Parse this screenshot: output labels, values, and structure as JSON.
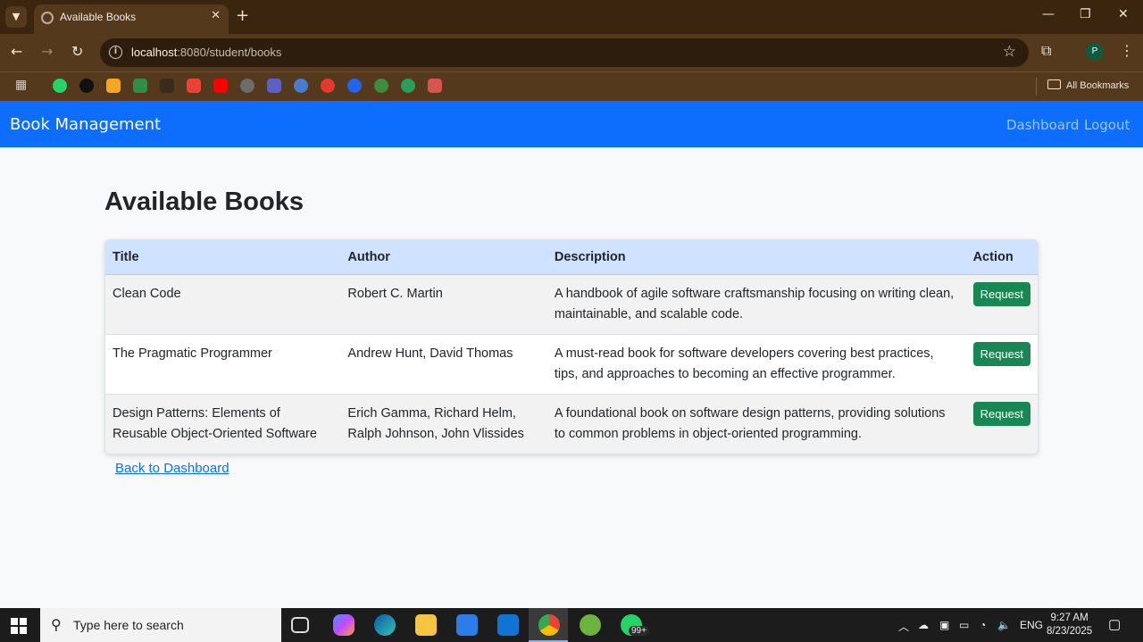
{
  "browser": {
    "tab_title": "Available Books",
    "url_host": "localhost",
    "url_rest": ":8080/student/books",
    "all_bookmarks_label": "All Bookmarks",
    "profile_initial": "P"
  },
  "navbar": {
    "brand": "Book Management",
    "links": [
      "Dashboard",
      "Logout"
    ]
  },
  "page": {
    "heading": "Available Books",
    "back_link": "Back to Dashboard"
  },
  "table": {
    "columns": [
      "Title",
      "Author",
      "Description",
      "Action"
    ],
    "rows": [
      {
        "title": "Clean Code",
        "author": "Robert C. Martin",
        "description": "A handbook of agile software craftsmanship focusing on writing clean, maintainable, and scalable code.",
        "action": "Request"
      },
      {
        "title": "The Pragmatic Programmer",
        "author": "Andrew Hunt, David Thomas",
        "description": "A must-read book for software developers covering best practices, tips, and approaches to becoming an effective programmer.",
        "action": "Request"
      },
      {
        "title": "Design Patterns: Elements of Reusable Object-Oriented Software",
        "author": "Erich Gamma, Richard Helm, Ralph Johnson, John Vlissides",
        "description": "A foundational book on software design patterns, providing solutions to common problems in object-oriented programming.",
        "action": "Request"
      }
    ]
  },
  "taskbar": {
    "search_placeholder": "Type here to search",
    "notification_badge": "99+",
    "language": "ENG",
    "time": "9:27 AM",
    "date": "8/23/2025"
  },
  "colors": {
    "navbar": "#0d6efd",
    "table_header": "#cfe2ff",
    "request_button": "#198754",
    "browser_frame": "#54391c"
  }
}
